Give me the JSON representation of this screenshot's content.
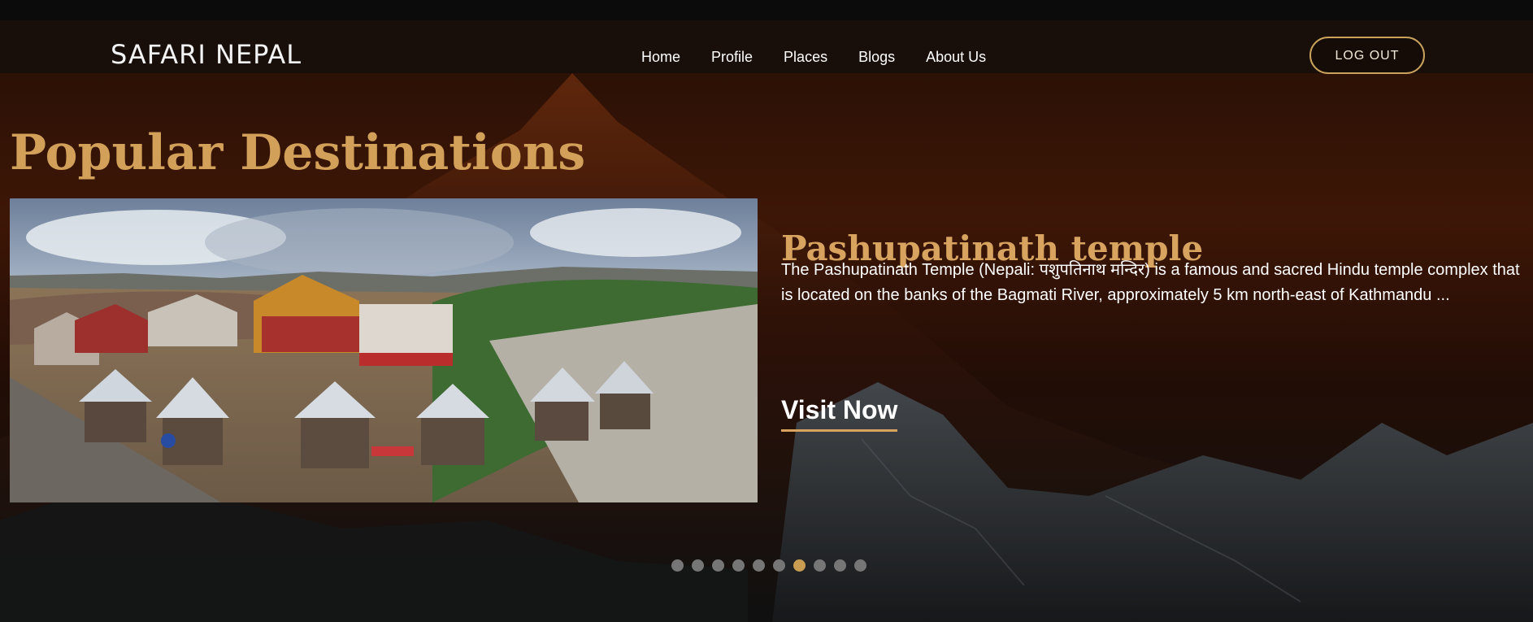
{
  "site": {
    "brand": "SAFARI NEPAL"
  },
  "nav": {
    "items": [
      "Home",
      "Profile",
      "Places",
      "Blogs",
      "About Us"
    ],
    "logout_label": "LOG OUT"
  },
  "hero": {
    "title": "Popular Destinations"
  },
  "slide": {
    "title": "Pashupatinath temple",
    "description": "The Pashupatinath Temple (Nepali: पशुपतिनाथ मन्दिर) is a famous and sacred Hindu temple complex that is located on the banks of the Bagmati River, approximately 5 km north-east of Kathmandu ...",
    "cta_label": "Visit Now"
  },
  "carousel": {
    "total_slides": 10,
    "active_slide": 7
  },
  "colors": {
    "accent": "#d2a059",
    "dot_inactive": "#777676",
    "dot_active": "#c89d52",
    "nav_bg": "#17100b"
  }
}
